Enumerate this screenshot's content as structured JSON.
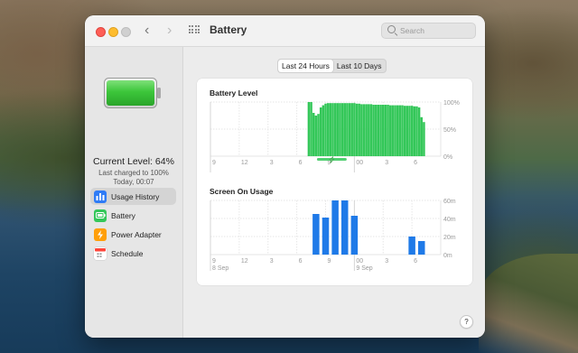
{
  "window": {
    "title": "Battery",
    "nav": {
      "back": "‹",
      "forward": "›"
    },
    "search": {
      "placeholder": "Search",
      "value": ""
    }
  },
  "battery_status": {
    "current_level": "Current Level: 64%",
    "last_charged": "Last charged to 100%",
    "charged_time": "Today, 00:07",
    "fill_fraction": 1.0,
    "fill_color": "#35c23c"
  },
  "sidebar": {
    "items": [
      {
        "label": "Usage History",
        "icon": "bar-chart-icon",
        "color": "#2f7cf6",
        "selected": true
      },
      {
        "label": "Battery",
        "icon": "battery-icon",
        "color": "#34c759",
        "selected": false
      },
      {
        "label": "Power Adapter",
        "icon": "power-adapter-icon",
        "color": "#ff9f0a",
        "selected": false
      },
      {
        "label": "Schedule",
        "icon": "calendar-icon",
        "color": "#ff453a",
        "selected": false
      }
    ]
  },
  "range_selector": {
    "options": [
      "Last 24 Hours",
      "Last 10 Days"
    ],
    "selected": "Last 24 Hours"
  },
  "help": {
    "label": "?"
  },
  "chart_data": [
    {
      "type": "bar",
      "title": "Battery Level",
      "color": "#34c759",
      "y_tick_labels": [
        "100%",
        "50%",
        "0%"
      ],
      "ylim": [
        0,
        100
      ],
      "x_tick_labels": [
        "9",
        "12",
        "3",
        "6",
        "9",
        "00",
        "3",
        "6"
      ],
      "x_hours": [
        9,
        12,
        15,
        18,
        21,
        24,
        27,
        30
      ],
      "xlim": [
        9,
        33
      ],
      "charging_indicator": {
        "start_hour": 20.1,
        "end_hour": 23.2,
        "color": "#34c759"
      },
      "bars": {
        "x_hours": [
          19.25,
          19.5,
          19.75,
          20.0,
          20.25,
          20.5,
          20.75,
          21.0,
          21.25,
          21.5,
          21.75,
          22.0,
          22.25,
          22.5,
          22.75,
          23.0,
          23.25,
          23.5,
          23.75,
          24.0,
          24.25,
          24.5,
          24.75,
          25.0,
          25.25,
          25.5,
          25.75,
          26.0,
          26.25,
          26.5,
          26.75,
          27.0,
          27.25,
          27.5,
          27.75,
          28.0,
          28.25,
          28.5,
          28.75,
          29.0,
          29.25,
          29.5,
          29.75,
          30.0,
          30.25,
          30.5,
          30.75,
          31.0,
          31.25
        ],
        "values": [
          100,
          100,
          80,
          75,
          78,
          90,
          94,
          97,
          98,
          98,
          98,
          98,
          98,
          98,
          98,
          98,
          98,
          98,
          98,
          98,
          97,
          97,
          96,
          96,
          96,
          96,
          96,
          95,
          95,
          95,
          95,
          95,
          95,
          95,
          94,
          94,
          94,
          94,
          94,
          94,
          93,
          93,
          93,
          93,
          92,
          92,
          90,
          72,
          63
        ]
      }
    },
    {
      "type": "bar",
      "title": "Screen On Usage",
      "color": "#1f7ae8",
      "y_tick_labels": [
        "60m",
        "40m",
        "20m",
        "0m"
      ],
      "ylim": [
        0,
        60
      ],
      "x_tick_labels": [
        "9",
        "12",
        "3",
        "6",
        "9",
        "00",
        "3",
        "6"
      ],
      "x_hours": [
        9,
        12,
        15,
        18,
        21,
        24,
        27,
        30
      ],
      "date_labels": [
        {
          "label": "8 Sep",
          "hour": 9
        },
        {
          "label": "9 Sep",
          "hour": 24
        }
      ],
      "xlim": [
        9,
        33
      ],
      "bars": {
        "x_hours": [
          20,
          21,
          22,
          23,
          24,
          30,
          31
        ],
        "values": [
          45,
          41,
          60,
          60,
          43,
          20,
          15
        ]
      }
    }
  ]
}
